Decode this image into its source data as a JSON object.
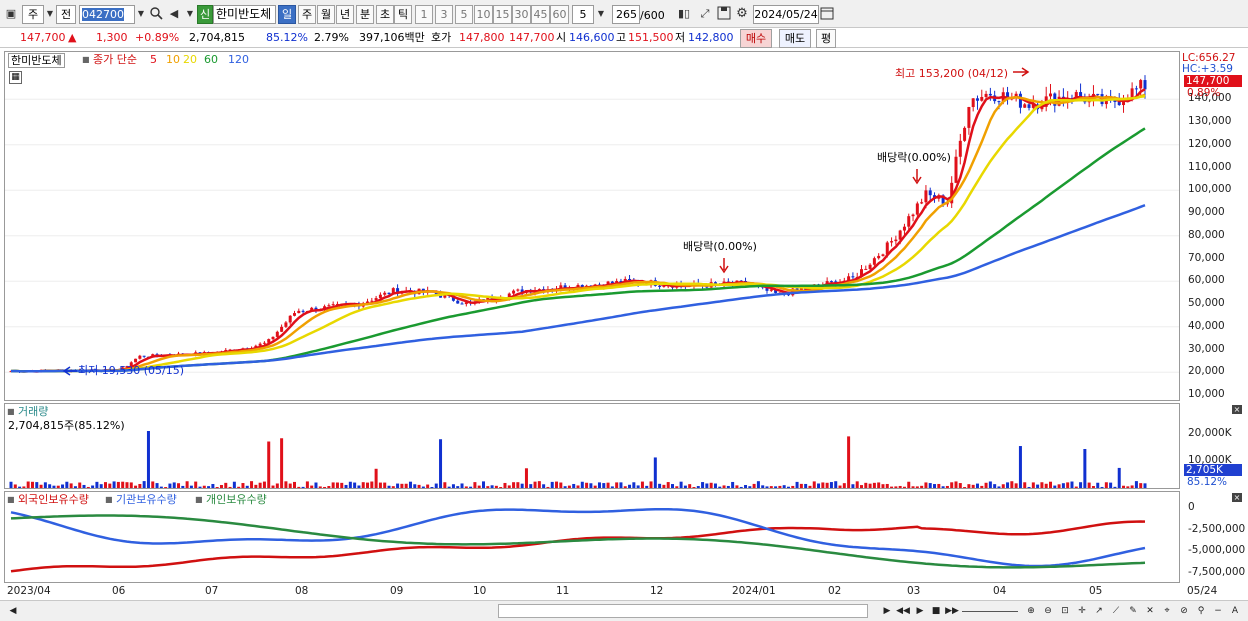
{
  "toolbar": {
    "market": "주",
    "prev_label": "전",
    "code": "042700",
    "new_badge": "신",
    "stock_name": "한미반도체",
    "periods": [
      "일",
      "주",
      "월",
      "년",
      "분",
      "초",
      "틱"
    ],
    "minutes": [
      "1",
      "3",
      "5",
      "10",
      "15",
      "30",
      "45",
      "60"
    ],
    "interval_value": "5",
    "count": "265",
    "count_max": "/600",
    "date": "2024/05/24"
  },
  "quote": {
    "price": "147,700",
    "direction": "▲",
    "change": "1,300",
    "change_pct": "+0.89%",
    "volume": "2,704,815",
    "vol_ratio": "85.12%",
    "turnover": "2.79%",
    "amount": "397,106백만",
    "hoga_label": "호가",
    "ask": "147,800",
    "bid": "147,700",
    "open_label": "시",
    "open": "146,600",
    "high_label": "고",
    "high": "151,500",
    "low_label": "저",
    "low": "142,800",
    "buy": "매수",
    "sell": "매도",
    "eval": "평"
  },
  "legend": {
    "name": "한미반도체",
    "series_label": "종가 단순",
    "ma": [
      "5",
      "10",
      "20",
      "60",
      "120"
    ],
    "ma_colors": [
      "#e0101a",
      "#f0a000",
      "#e8d800",
      "#1a9a30",
      "#3060e0"
    ]
  },
  "price_axis": {
    "ticks": [
      "140,000",
      "130,000",
      "120,000",
      "110,000",
      "100,000",
      "90,000",
      "80,000",
      "70,000",
      "60,000",
      "50,000",
      "40,000",
      "30,000",
      "20,000",
      "10,000"
    ],
    "lc": "LC:656.27",
    "hc": "HC:+3.59",
    "last": "147,700",
    "last_pct": "0.89%"
  },
  "annotations": {
    "high": "최고 153,200 (04/12)",
    "low": "최저 19,530 (05/15)",
    "div1": "배당락(0.00%)",
    "div2": "배당락(0.00%)"
  },
  "volume_panel": {
    "title": "거래량",
    "value": "2,704,815주(85.12%)",
    "ticks": [
      "20,000K",
      "10,000K"
    ],
    "last": "2,705K",
    "last_pct": "85.12%"
  },
  "holdings_panel": {
    "series": [
      {
        "name": "외국인보유수량",
        "color": "#d01010"
      },
      {
        "name": "기관보유수량",
        "color": "#3060e0"
      },
      {
        "name": "개인보유수량",
        "color": "#2a8a40"
      }
    ],
    "ticks": [
      "0",
      "-2,500,000",
      "-5,000,000",
      "-7,500,000"
    ]
  },
  "x_axis": {
    "labels": [
      "2023/04",
      "06",
      "07",
      "08",
      "09",
      "10",
      "11",
      "12",
      "2024/01",
      "02",
      "03",
      "04",
      "05",
      "05/24"
    ]
  },
  "icons": [
    "search-icon",
    "speaker-icon",
    "chart-icon",
    "save-icon",
    "gear-icon",
    "calendar-icon"
  ],
  "colors": {
    "up": "#e0101a",
    "down": "#1030d0",
    "accent": "#3b6fc4"
  }
}
